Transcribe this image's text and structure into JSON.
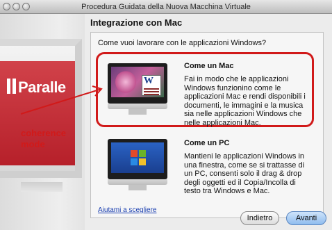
{
  "window": {
    "title": "Procedura Guidata della Nuova Macchina Virtuale"
  },
  "sidebar": {
    "logo_text": "Paralle",
    "annotation": "coherence\nmode"
  },
  "main": {
    "title": "Integrazione con Mac",
    "question": "Come vuoi lavorare con le applicazioni Windows?",
    "options": [
      {
        "title": "Come un Mac",
        "description": "Fai in modo che le applicazioni Windows funzionino come le applicazioni Mac e rendi disponibili i documenti, le immagini e la musica sia nelle applicazioni Windows che nelle applicazioni Mac.",
        "icon": "imac-mac-icon",
        "highlighted": true
      },
      {
        "title": "Come un PC",
        "description": "Mantieni le applicazioni Windows in una finestra, come se si trattasse di un PC, consenti solo il drag & drop degli oggetti ed il Copia/Incolla di testo tra Windows e Mac.",
        "icon": "imac-windows-icon",
        "highlighted": false
      }
    ],
    "help_link": "Aiutami a scegliere"
  },
  "buttons": {
    "back": "Indietro",
    "next": "Avanti"
  },
  "colors": {
    "annotation": "#d11a1a",
    "link": "#1a3fb0"
  }
}
